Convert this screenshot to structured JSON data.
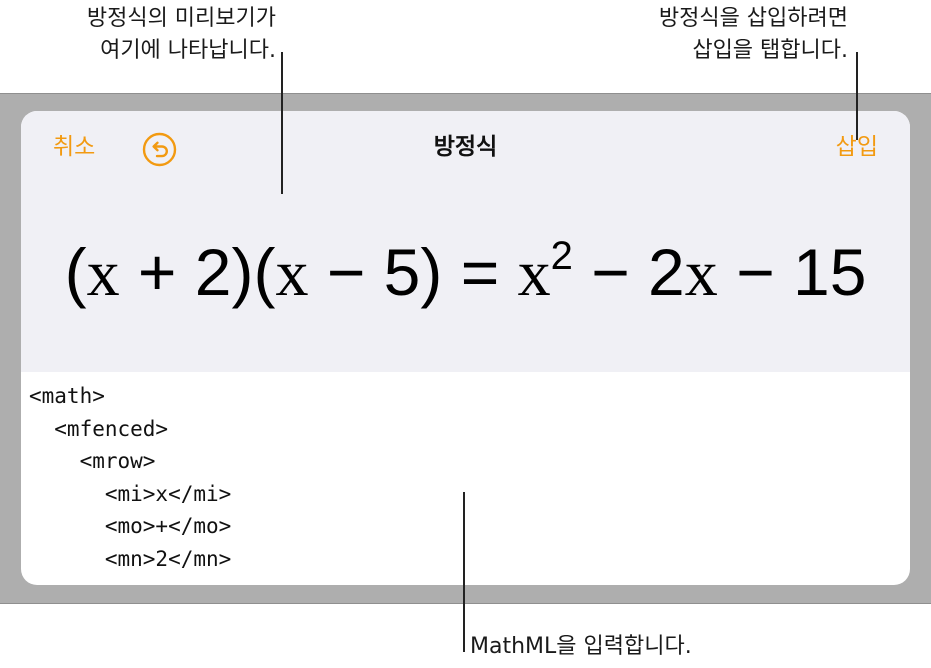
{
  "callouts": {
    "preview": {
      "line1": "방정식의 미리보기가",
      "line2": "여기에 나타납니다."
    },
    "insert": {
      "line1": "방정식을 삽입하려면",
      "line2": "삽입을 탭합니다."
    },
    "mathml": "MathML을 입력합니다."
  },
  "nav": {
    "cancel": "취소",
    "undo_icon": "undo-icon",
    "title": "방정식",
    "insert": "삽입"
  },
  "equation": {
    "p1": "(",
    "x1": "x",
    "p2": " + 2)(",
    "x2": "x",
    "p3": " − 5) = ",
    "x3": "x",
    "exp": "2",
    "p4": " − 2",
    "x4": "x",
    "p5": " − 15"
  },
  "editor": {
    "lines": [
      "<math>",
      "  <mfenced>",
      "    <mrow>",
      "      <mi>x</mi>",
      "      <mo>+</mo>",
      "      <mn>2</mn>"
    ]
  },
  "colors": {
    "accent": "#f29a11",
    "backdrop": "#aeaeae",
    "preview_bg": "#f0f0f5"
  }
}
